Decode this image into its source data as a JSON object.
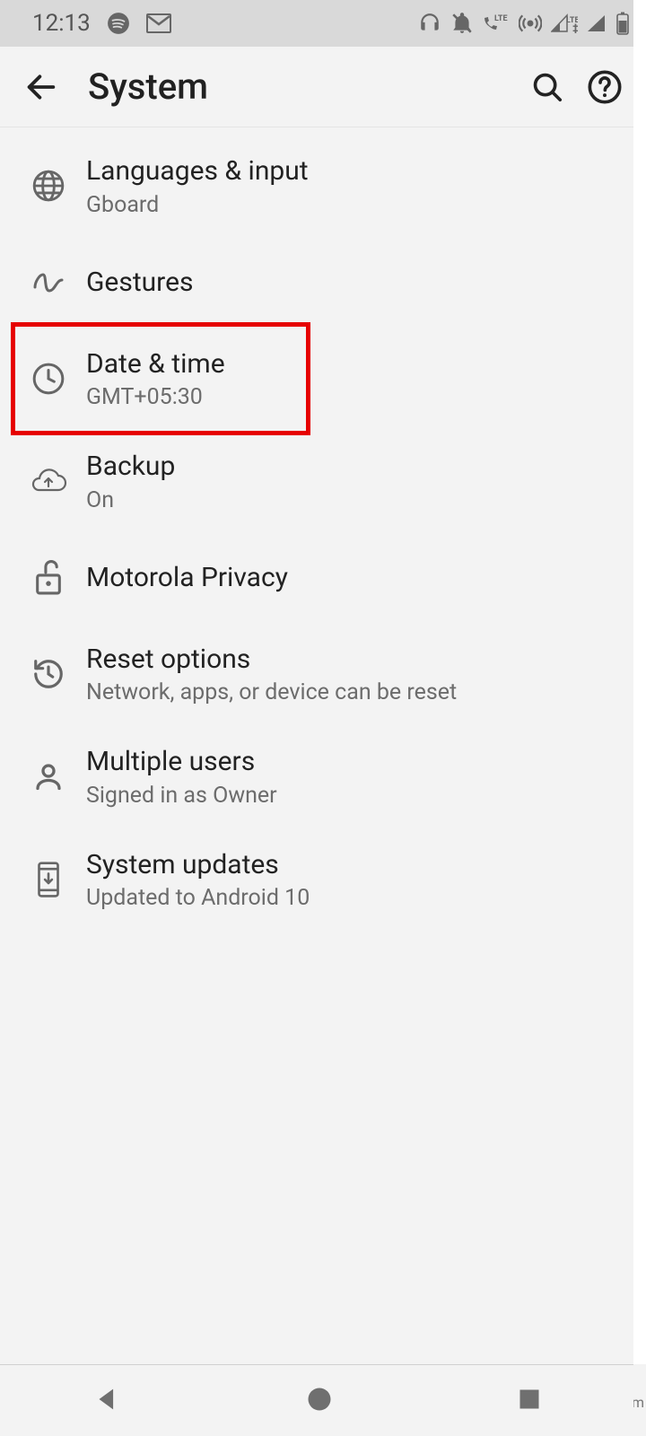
{
  "status_bar": {
    "time": "12:13"
  },
  "app_bar": {
    "title": "System"
  },
  "settings": [
    {
      "title": "Languages & input",
      "sub": "Gboard"
    },
    {
      "title": "Gestures",
      "sub": ""
    },
    {
      "title": "Date & time",
      "sub": "GMT+05:30"
    },
    {
      "title": "Backup",
      "sub": "On"
    },
    {
      "title": "Motorola Privacy",
      "sub": ""
    },
    {
      "title": "Reset options",
      "sub": "Network, apps, or device can be reset"
    },
    {
      "title": "Multiple users",
      "sub": "Signed in as Owner"
    },
    {
      "title": "System updates",
      "sub": "Updated to Android 10"
    }
  ],
  "watermark": "wsxdn.com"
}
